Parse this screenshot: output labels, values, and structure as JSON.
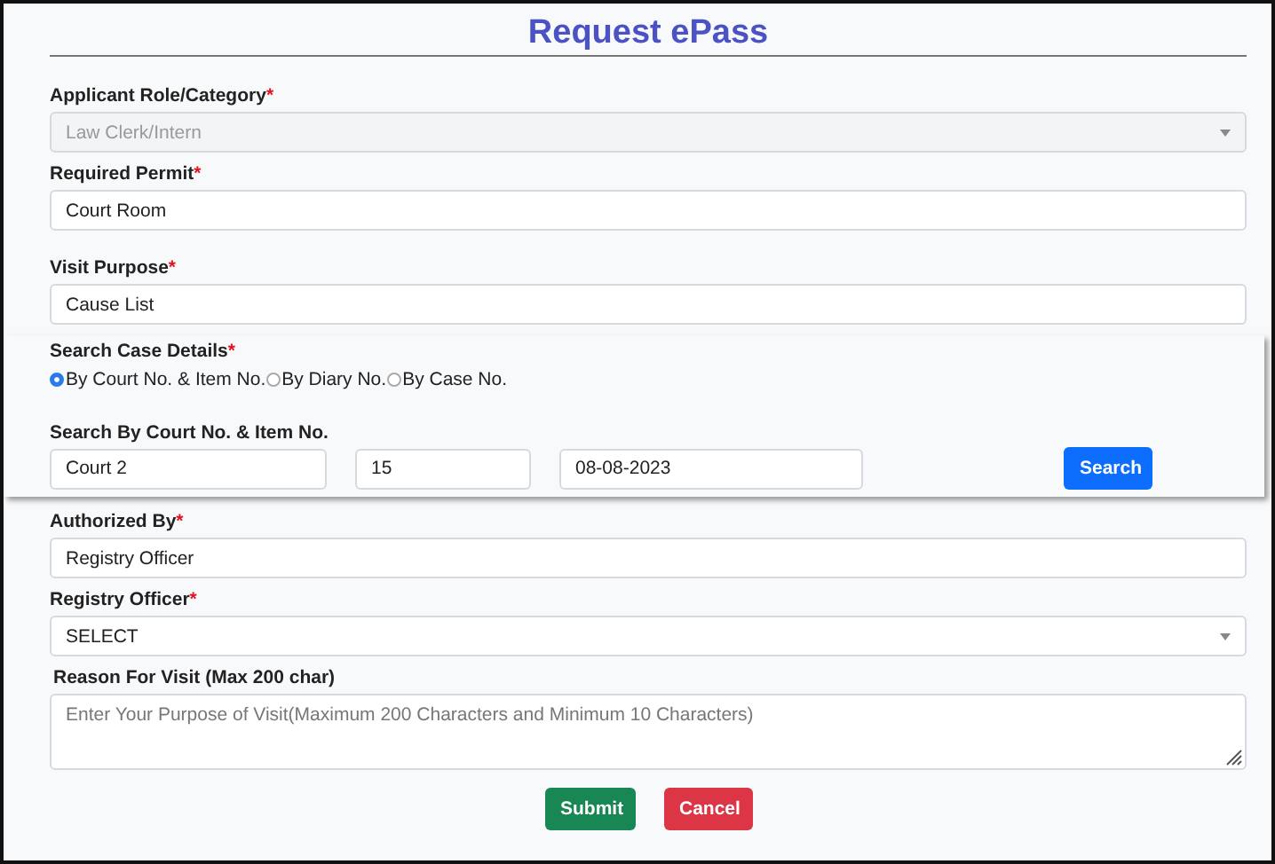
{
  "title": "Request ePass",
  "fields": [
    {
      "kind": "select",
      "label": "Applicant Role/Category",
      "marker": "*",
      "value": "Law Clerk/Intern",
      "disabled": true
    },
    {
      "kind": "input",
      "label": "Required Permit",
      "marker": "*",
      "value": "Court Room",
      "disabled": false
    },
    {
      "kind": "input",
      "label": "Visit Purpose",
      "marker": "*",
      "value": "Cause List",
      "disabled": false
    },
    {
      "kind": "search_panel",
      "label": "Search Case Details",
      "marker": "*",
      "options": [
        {
          "label": "By Court No. & Item No.",
          "selected": true
        },
        {
          "label": "By Diary No.",
          "selected": false
        },
        {
          "label": "By Case No.",
          "selected": false
        }
      ],
      "sublabel": "Search By Court No. & Item No.",
      "inputs": [
        {
          "value": "Court 2"
        },
        {
          "value": "15"
        },
        {
          "value": "08-08-2023"
        }
      ],
      "button": "Search"
    },
    {
      "kind": "input",
      "label": "Authorized By",
      "marker": "*",
      "value": "Registry Officer",
      "disabled": false
    },
    {
      "kind": "select",
      "label": "Registry Officer",
      "marker": "*",
      "value": "SELECT",
      "disabled": false
    },
    {
      "kind": "textarea",
      "label": "Reason For Visit (Max 200 char)",
      "placeholder": "Enter Your Purpose of Visit(Maximum 200 Characters and Minimum 10 Characters)"
    }
  ],
  "buttons": [
    {
      "label": "Submit",
      "kind": "primary"
    },
    {
      "label": "Cancel",
      "kind": "danger"
    }
  ]
}
